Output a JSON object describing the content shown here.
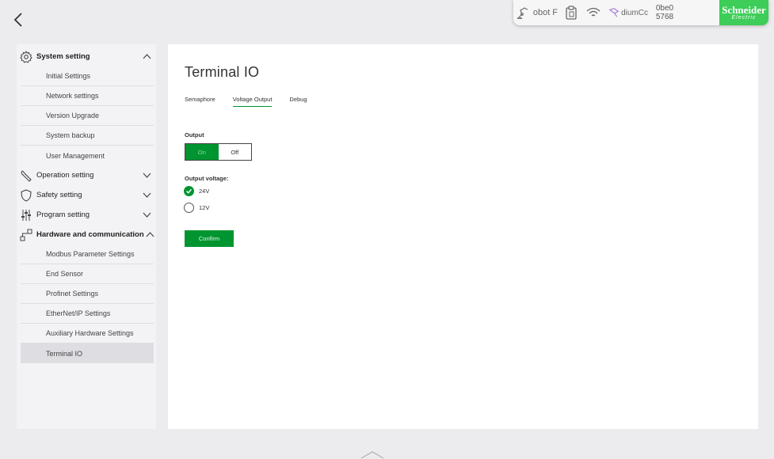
{
  "status_bar": {
    "robot_text": "obot",
    "robot_sub": "F",
    "plugin_text": "diumCc",
    "code_line1": "0be0",
    "code_line2": "5768",
    "logo_brand": "Schneider",
    "logo_sub": "Electric",
    "logo_color": "#3dcd58"
  },
  "sidebar": {
    "system": {
      "label": "System setting",
      "items": [
        "Initial Settings",
        "Network settings",
        "Version Upgrade",
        "System backup",
        "User Management"
      ]
    },
    "operation": {
      "label": "Operation setting"
    },
    "safety": {
      "label": "Safety setting"
    },
    "program": {
      "label": "Program setting"
    },
    "hardware": {
      "label": "Hardware and communication",
      "items": [
        "Modbus Parameter Settings",
        "End Sensor",
        "Profinet Settings",
        "EtherNet/IP Settings",
        "Auxiliary Hardware Settings",
        "Terminal IO"
      ]
    }
  },
  "main": {
    "title": "Terminal IO",
    "tabs": [
      "Semaphore",
      "Voltage Output",
      "Debug"
    ],
    "active_tab": "Voltage Output",
    "output_label": "Output",
    "toggle_on": "On",
    "toggle_off": "Off",
    "toggle_state": "On",
    "voltage_label": "Output voltage:",
    "voltage_options": [
      "24V",
      "12V"
    ],
    "voltage_selected": "24V",
    "confirm_label": "Confirm"
  },
  "colors": {
    "accent": "#009530",
    "background": "#ececee"
  }
}
